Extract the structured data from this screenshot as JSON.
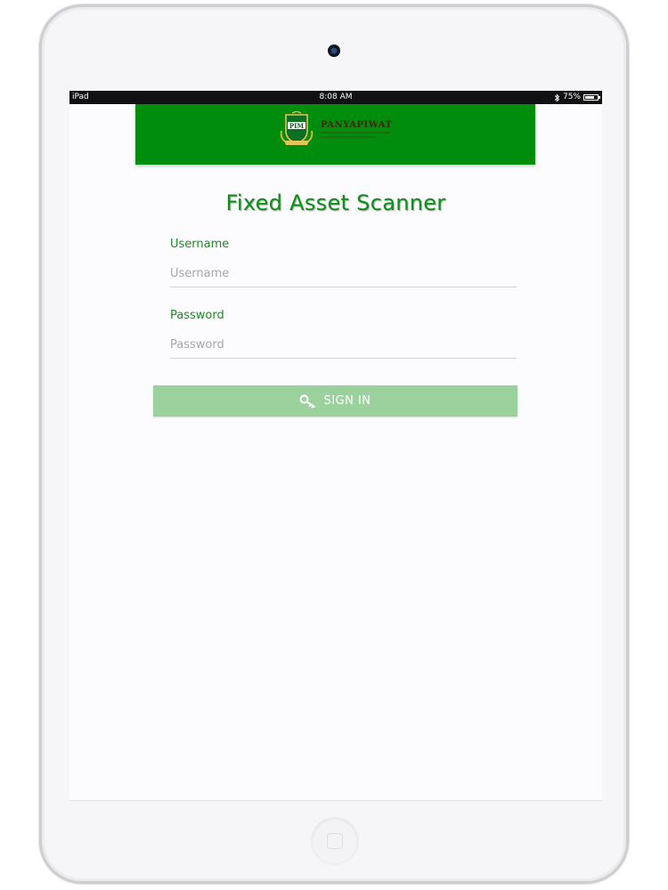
{
  "status_bar": {
    "device": "iPad",
    "time": "8:08 AM",
    "battery": "75%",
    "battery_level": 0.75,
    "icons": [
      "bluetooth-icon",
      "battery-icon"
    ]
  },
  "header": {
    "logo_abbr": "PIM",
    "logo_name": "PANYAPIWAT",
    "background_color": "#008c0c"
  },
  "login": {
    "title": "Fixed Asset Scanner",
    "username_label": "Username",
    "username_placeholder": "Username",
    "username_value": "",
    "password_label": "Password",
    "password_placeholder": "Password",
    "password_value": "",
    "signin_label": "SIGN IN",
    "signin_icon": "key-icon",
    "button_color": "#9bd19d",
    "accent_color": "#0e8f19"
  }
}
